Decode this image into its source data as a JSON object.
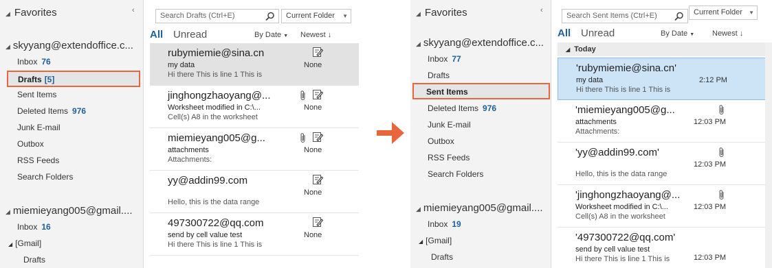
{
  "left": {
    "favorites": "Favorites",
    "account1": "skyyang@extendoffice.c...",
    "folders1": [
      {
        "label": "Inbox",
        "count": "76"
      },
      {
        "label": "Drafts",
        "count": "[5]"
      },
      {
        "label": "Sent Items",
        "count": ""
      },
      {
        "label": "Deleted Items",
        "count": "976"
      },
      {
        "label": "Junk E-mail",
        "count": ""
      },
      {
        "label": "Outbox",
        "count": ""
      },
      {
        "label": "RSS Feeds",
        "count": ""
      },
      {
        "label": "Search Folders",
        "count": ""
      }
    ],
    "account2": "miemieyang005@gmail....",
    "folders2": [
      {
        "label": "Inbox",
        "count": "16"
      },
      {
        "label": "[Gmail]",
        "count": ""
      },
      {
        "label": "Drafts",
        "count": ""
      }
    ],
    "search_placeholder": "Search Drafts (Ctrl+E)",
    "scope": "Current Folder",
    "filter_all": "All",
    "filter_unread": "Unread",
    "sort_by": "By Date",
    "sort_order": "Newest",
    "mails": [
      {
        "from": "rubymiemie@sina.cn",
        "subject": "my data",
        "preview": "Hi there  This is line 1  This is",
        "right": "None"
      },
      {
        "from": "jinghongzhaoyang@...",
        "subject": "Worksheet modified in C:\\...",
        "preview": "Cell(s) A8 in the worksheet",
        "right": "None"
      },
      {
        "from": "miemieyang005@g...",
        "subject": "attachments",
        "preview": "Attachments:",
        "right": "None"
      },
      {
        "from": "yy@addin99.com",
        "subject": "",
        "preview": "Hello, this is the data range",
        "right": "None"
      },
      {
        "from": "497300722@qq.com",
        "subject": "send by cell value test",
        "preview": "Hi there  This is line 1  This is",
        "right": "None"
      }
    ]
  },
  "right": {
    "favorites": "Favorites",
    "account1": "skyyang@extendoffice.c...",
    "folders1": [
      {
        "label": "Inbox",
        "count": "77"
      },
      {
        "label": "Drafts",
        "count": ""
      },
      {
        "label": "Sent Items",
        "count": ""
      },
      {
        "label": "Deleted Items",
        "count": "976"
      },
      {
        "label": "Junk E-mail",
        "count": ""
      },
      {
        "label": "Outbox",
        "count": ""
      },
      {
        "label": "RSS Feeds",
        "count": ""
      },
      {
        "label": "Search Folders",
        "count": ""
      }
    ],
    "account2": "miemieyang005@gmail....",
    "folders2": [
      {
        "label": "Inbox",
        "count": "19"
      },
      {
        "label": "[Gmail]",
        "count": ""
      },
      {
        "label": "Drafts",
        "count": ""
      }
    ],
    "search_placeholder": "Search Sent Items (Ctrl+E)",
    "scope": "Current Folder",
    "filter_all": "All",
    "filter_unread": "Unread",
    "sort_by": "By Date",
    "sort_order": "Newest",
    "group_label": "Today",
    "mails": [
      {
        "from": "'rubymiemie@sina.cn'",
        "subject": "my data",
        "preview": "Hi there  This is line 1  This is",
        "right": "2:12 PM"
      },
      {
        "from": "'miemieyang005@g...",
        "subject": "attachments",
        "preview": "Attachments:",
        "right": "12:03 PM"
      },
      {
        "from": "'yy@addin99.com'",
        "subject": "",
        "preview": "Hello, this is the data range",
        "right": "12:03 PM"
      },
      {
        "from": "'jinghongzhaoyang@...",
        "subject": "Worksheet modified in C:\\...",
        "preview": "Cell(s) A8 in the worksheet",
        "right": "12:03 PM"
      },
      {
        "from": "'497300722@qq.com'",
        "subject": "send by cell value test",
        "preview": "Hi there  This is line 1  This is",
        "right": "12:03 PM"
      }
    ]
  },
  "colors": {
    "highlight": "#e8663d",
    "accent": "#1f5f9c",
    "selected_blue": "#cde4f7"
  }
}
